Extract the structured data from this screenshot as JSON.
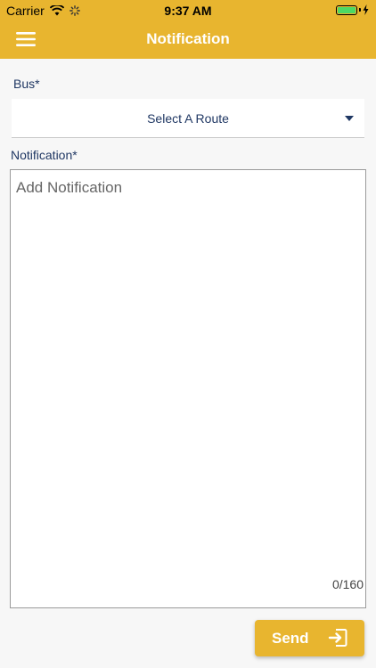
{
  "status_bar": {
    "carrier": "Carrier",
    "time": "9:37 AM",
    "wifi_icon": "wifi-icon",
    "activity_icon": "activity-spinner-icon",
    "battery_icon": "battery-icon",
    "charging_icon": "charging-bolt-icon"
  },
  "header": {
    "title": "Notification",
    "menu_icon": "hamburger-menu-icon",
    "background_color": "#e8b52f"
  },
  "form": {
    "bus_label": "Bus*",
    "route_select": {
      "selected": "Select A Route",
      "caret_icon": "caret-down-icon"
    },
    "notification_label": "Notification*",
    "notification_field": {
      "value": "",
      "placeholder": "Add Notification"
    },
    "char_counter": "0/160"
  },
  "actions": {
    "send_label": "Send",
    "send_icon": "sign-in-icon",
    "accent_color": "#e8b52f"
  }
}
